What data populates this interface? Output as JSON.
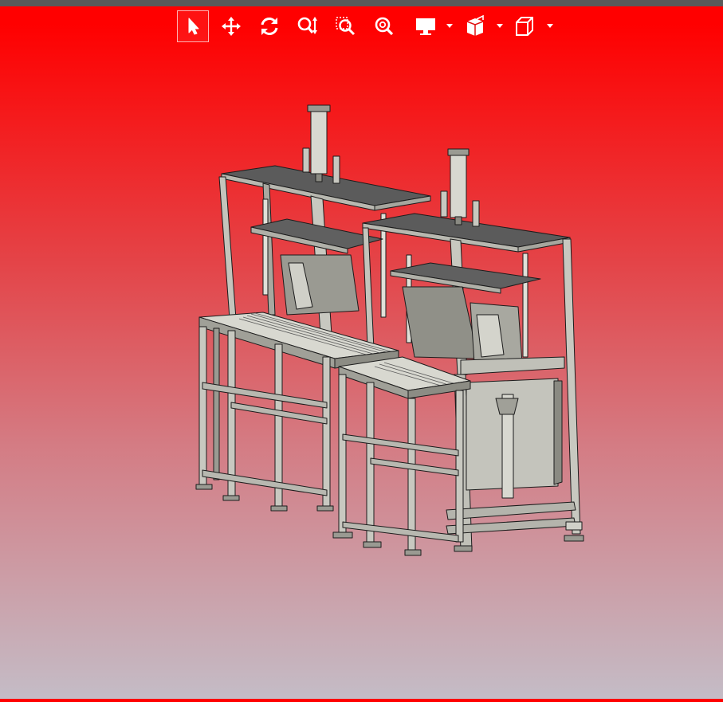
{
  "window": {
    "topbar_color": "#5a5a5a"
  },
  "toolbar": {
    "tools": [
      {
        "name": "select",
        "icon": "cursor-icon",
        "active": true
      },
      {
        "name": "pan",
        "icon": "move-arrows-icon",
        "active": false
      },
      {
        "name": "rotate",
        "icon": "rotate-icon",
        "active": false
      },
      {
        "name": "zoom",
        "icon": "zoom-updown-icon",
        "active": false
      },
      {
        "name": "zoom-window",
        "icon": "zoom-window-icon",
        "active": false
      },
      {
        "name": "zoom-fit",
        "icon": "zoom-fit-icon",
        "active": false
      },
      {
        "name": "display-mode",
        "icon": "monitor-icon",
        "dropdown": true
      },
      {
        "name": "section-view",
        "icon": "section-icon",
        "dropdown": true
      },
      {
        "name": "view-orientation",
        "icon": "cube-icon",
        "dropdown": true
      }
    ]
  },
  "viewport": {
    "background_top": "#ff0000",
    "background_bottom": "#c4bcc6",
    "model_color": "#b8b8b0",
    "model_edge_color": "#1c1c1c"
  }
}
